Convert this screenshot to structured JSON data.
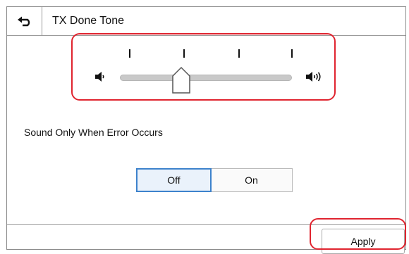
{
  "header": {
    "title": "TX Done Tone",
    "back_icon": "back-arrow-icon"
  },
  "volume": {
    "level": 2,
    "levels_total": 5,
    "min_icon": "speaker-low-icon",
    "max_icon": "speaker-high-icon"
  },
  "error_option": {
    "label": "Sound Only When Error Occurs",
    "options": [
      "Off",
      "On"
    ],
    "selected": "Off"
  },
  "footer": {
    "apply_label": "Apply"
  },
  "colors": {
    "highlight": "#e0242f",
    "selected_border": "#3d82cc",
    "selected_bg": "#eaf2fb"
  }
}
